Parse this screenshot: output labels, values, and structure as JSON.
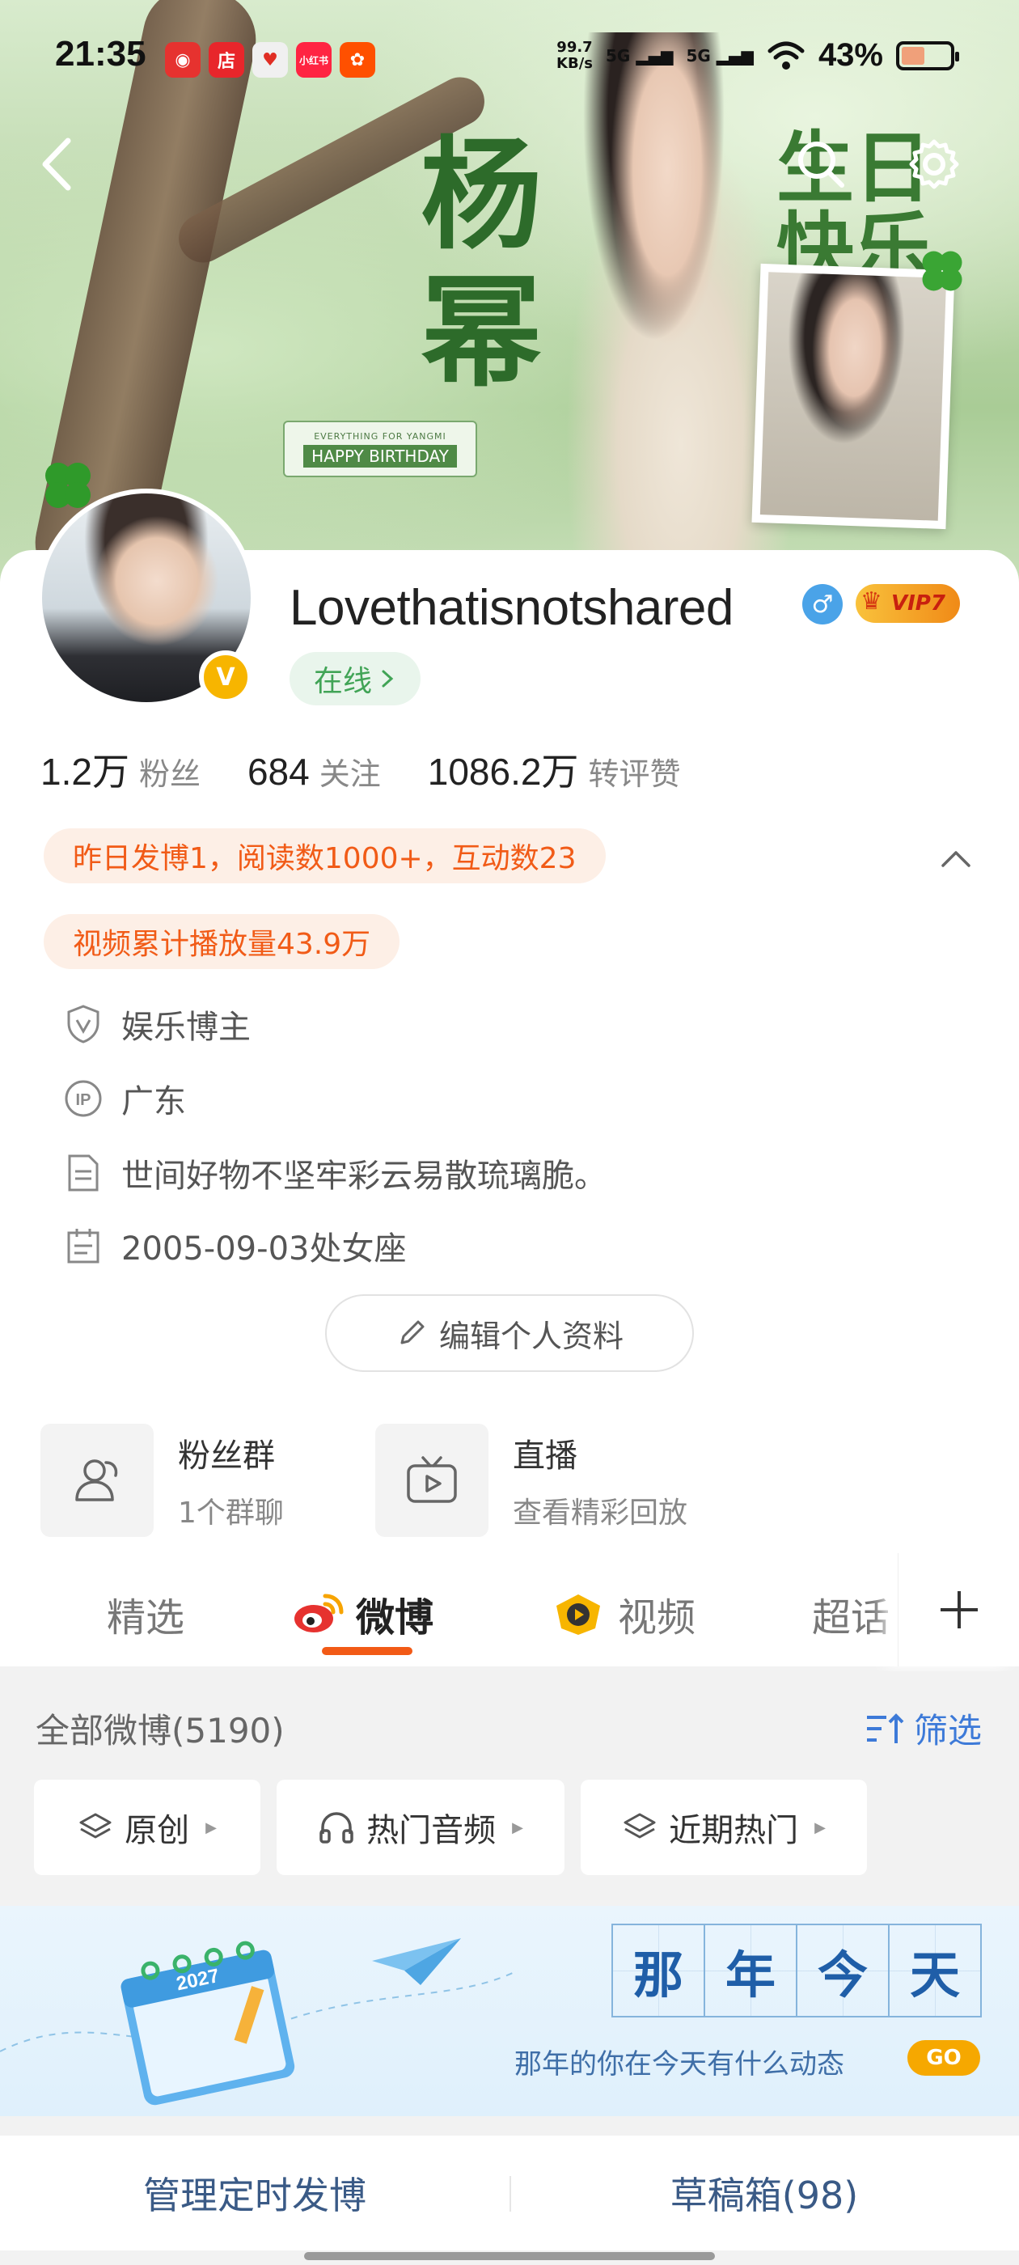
{
  "status_bar": {
    "time": "21:35",
    "net_speed_value": "99.7",
    "net_speed_unit": "KB/s",
    "signal_1": "5G",
    "signal_2": "5G",
    "battery_percent": "43%",
    "battery_level": 0.43,
    "app_icons": [
      "weibo-icon",
      "taobao-shop-icon",
      "pinduoduo-icon",
      "xiaohongshu-icon",
      "kuaishou-icon"
    ],
    "app_icon_labels": [
      "",
      "店",
      "",
      "小红书",
      ""
    ]
  },
  "banner": {
    "big_text_left": [
      "杨",
      "幂"
    ],
    "big_text_right": [
      "生日",
      "快乐"
    ],
    "tag_small": "EVERYTHING FOR YANGMI",
    "tag_big": "HAPPY BIRTHDAY"
  },
  "profile": {
    "username": "Lovethatisnotshared",
    "gender_icon": "male-icon",
    "vip_label": "VIP7",
    "verified_badge": "V",
    "online_status": "在线",
    "stats": [
      {
        "num": "1.2万",
        "label": "粉丝"
      },
      {
        "num": "684",
        "label": "关注"
      },
      {
        "num": "1086.2万",
        "label": "转评赞"
      }
    ],
    "highlight_1": "昨日发博1，阅读数1000+，互动数23",
    "highlight_2": "视频累计播放量43.9万",
    "info": [
      {
        "icon": "shield-icon",
        "text": "娱乐博主"
      },
      {
        "icon": "ip-icon",
        "text": "广东"
      },
      {
        "icon": "document-icon",
        "text": "世间好物不坚牢彩云易散琉璃脆。"
      },
      {
        "icon": "calendar-icon",
        "text": "2005-09-03处女座"
      }
    ],
    "edit_button": "编辑个人资料"
  },
  "shortcuts": [
    {
      "title": "粉丝群",
      "subtitle": "1个群聊",
      "icon": "group-icon"
    },
    {
      "title": "直播",
      "subtitle": "查看精彩回放",
      "icon": "live-tv-icon"
    }
  ],
  "tabs": [
    {
      "label": "精选",
      "active": false
    },
    {
      "label": "微博",
      "active": true,
      "icon": "weibo-icon"
    },
    {
      "label": "视频",
      "active": false,
      "icon": "video-play-icon"
    },
    {
      "label": "超话",
      "active": false
    }
  ],
  "feed": {
    "title": "全部微博(5190)",
    "filter_label": "筛选",
    "chips": [
      {
        "label": "原创",
        "icon": "layers-icon"
      },
      {
        "label": "热门音频",
        "icon": "headphones-icon"
      },
      {
        "label": "近期热门",
        "icon": "layers-icon"
      }
    ],
    "memory_banner": {
      "chars": [
        "那",
        "年",
        "今",
        "天"
      ],
      "subtitle": "那年的你在今天有什么动态",
      "go": "GO",
      "calendar_year": "2027"
    }
  },
  "bottom_actions": {
    "left": "管理定时发博",
    "right": "草稿箱(98)"
  }
}
